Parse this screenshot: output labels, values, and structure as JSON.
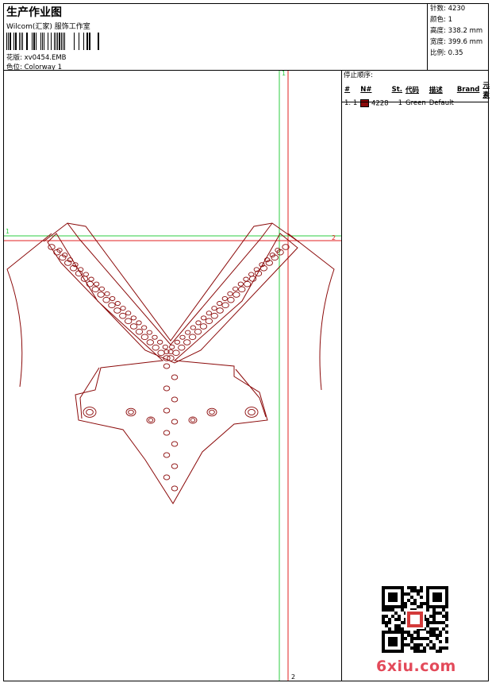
{
  "header": {
    "title": "生产作业图",
    "subtitle": "Wilcom(汇家) 服饰工作室",
    "design_label": "花版:",
    "design_value": "xv0454.EMB",
    "color_label": "色位:",
    "color_value": "Colorway 1"
  },
  "stats": [
    {
      "label": "针数:",
      "value": "4230"
    },
    {
      "label": "颜色:",
      "value": "1"
    },
    {
      "label": "高度:",
      "value": "338.2 mm"
    },
    {
      "label": "宽度:",
      "value": "399.6 mm"
    },
    {
      "label": "比例:",
      "value": "0.35"
    }
  ],
  "stop_sequence": {
    "title": "停止顺序:",
    "columns": [
      "#",
      "N#",
      "St.",
      "代码",
      "描述",
      "Brand",
      "元素"
    ],
    "rows": [
      {
        "index": "1.",
        "needle": "1",
        "stitches": "4228",
        "code": "1",
        "description": "Green",
        "brand": "Default",
        "swatch_color": "#8b0a0a"
      }
    ]
  },
  "guides": {
    "v_top": "1",
    "v_bottom": "2",
    "h_left": "1",
    "h_right": "2"
  },
  "design_color": "#8b0a0a",
  "guide_green": "#2ecc40",
  "guide_red": "#e02020",
  "watermark": "6xiu.com",
  "watermark_color": "#e34a5a"
}
